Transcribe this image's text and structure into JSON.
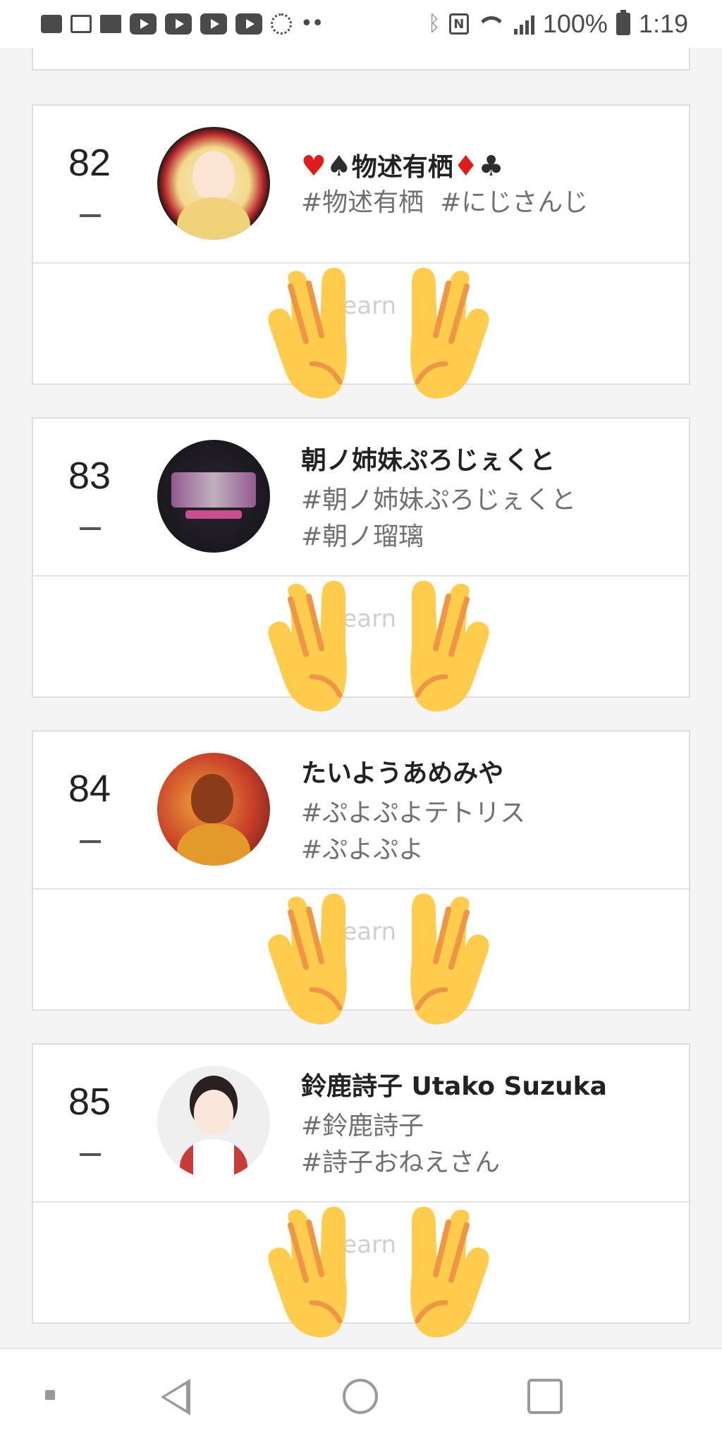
{
  "status_bar": {
    "battery": "100%",
    "time": "1:19"
  },
  "entries": [
    {
      "rank": "82",
      "name_prefix": "♥♠",
      "name": "物述有栖",
      "name_suffix": "♦♣",
      "tags": [
        "#物述有栖",
        "#にじさんじ"
      ],
      "hidden_label": "Learn"
    },
    {
      "rank": "83",
      "name_prefix": "",
      "name": "朝ノ姉妹ぷろじぇくと",
      "name_suffix": "",
      "tags": [
        "#朝ノ姉妹ぷろじぇくと",
        "#朝ノ瑠璃"
      ],
      "hidden_label": "Learn"
    },
    {
      "rank": "84",
      "name_prefix": "",
      "name": "たいようあめみや",
      "name_suffix": "",
      "tags": [
        "#ぷよぷよテトリス",
        "#ぷよぷよ"
      ],
      "hidden_label": "Learn"
    },
    {
      "rank": "85",
      "name_prefix": "",
      "name": "鈴鹿詩子 Utako Suzuka",
      "name_suffix": "",
      "tags": [
        "#鈴鹿詩子",
        "#詩子おねえさん"
      ],
      "hidden_label": "Learn"
    }
  ],
  "icons": {
    "hands": "raising-hands-emoji-icon",
    "nav_back": "back-triangle-icon",
    "nav_home": "home-circle-icon",
    "nav_recent": "recent-apps-square-icon"
  },
  "colors": {
    "hands_fill": "#FFCC4D",
    "hands_detail": "#EF9645",
    "suit_red": "#E01B1B"
  }
}
